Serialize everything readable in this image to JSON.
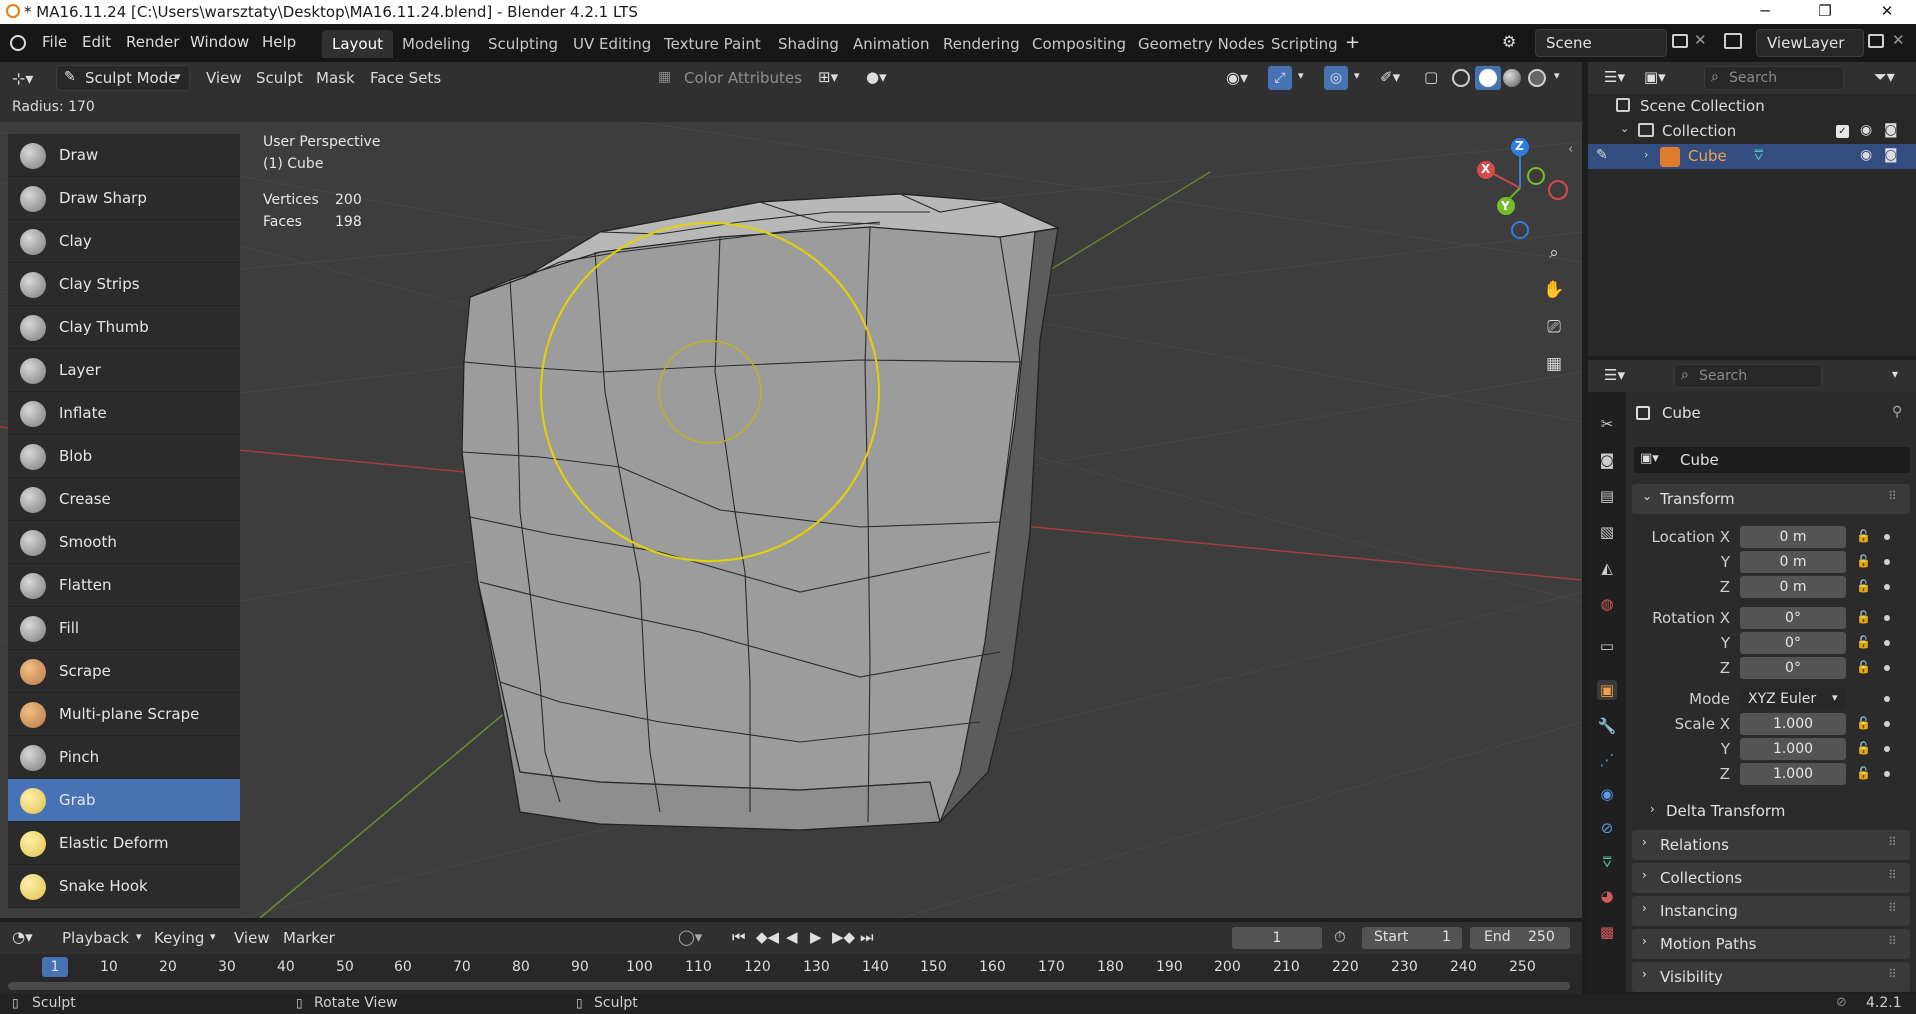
{
  "window": {
    "title": "* MA16.11.24 [C:\\Users\\warsztaty\\Desktop\\MA16.11.24.blend] - Blender 4.2.1 LTS",
    "controls": [
      "─",
      "❐",
      "✕"
    ]
  },
  "menu": [
    "File",
    "Edit",
    "Render",
    "Window",
    "Help"
  ],
  "workspaces": [
    "Layout",
    "Modeling",
    "Sculpting",
    "UV Editing",
    "Texture Paint",
    "Shading",
    "Animation",
    "Rendering",
    "Compositing",
    "Geometry Nodes",
    "Scripting"
  ],
  "active_workspace": "Layout",
  "scene": {
    "label": "Scene",
    "view_layer": "ViewLayer"
  },
  "viewport_header": {
    "mode": "Sculpt Mode",
    "menus": [
      "View",
      "Sculpt",
      "Mask",
      "Face Sets"
    ],
    "color_attributes": "Color Attributes",
    "radius": "Radius: 170"
  },
  "viewport": {
    "perspective": "User Perspective",
    "object": "(1) Cube",
    "stats": [
      {
        "label": "Vertices",
        "value": "200"
      },
      {
        "label": "Faces",
        "value": "198"
      }
    ],
    "gizmo": {
      "x": "X",
      "y": "Y",
      "z": "Z"
    }
  },
  "brushes": [
    {
      "label": "Draw",
      "style": "g"
    },
    {
      "label": "Draw Sharp",
      "style": "g"
    },
    {
      "label": "Clay",
      "style": "g"
    },
    {
      "label": "Clay Strips",
      "style": "g"
    },
    {
      "label": "Clay Thumb",
      "style": "g"
    },
    {
      "label": "Layer",
      "style": "g"
    },
    {
      "label": "Inflate",
      "style": "g"
    },
    {
      "label": "Blob",
      "style": "g"
    },
    {
      "label": "Crease",
      "style": "g"
    },
    {
      "label": "Smooth",
      "style": "g"
    },
    {
      "label": "Flatten",
      "style": "g"
    },
    {
      "label": "Fill",
      "style": "g"
    },
    {
      "label": "Scrape",
      "style": "c"
    },
    {
      "label": "Multi-plane Scrape",
      "style": "c"
    },
    {
      "label": "Pinch",
      "style": "g"
    },
    {
      "label": "Grab",
      "style": "y",
      "active": true
    },
    {
      "label": "Elastic Deform",
      "style": "y"
    },
    {
      "label": "Snake Hook",
      "style": "y"
    }
  ],
  "outliner": {
    "search_placeholder": "Search",
    "rows": [
      "Scene Collection",
      "Collection",
      "Cube"
    ]
  },
  "properties": {
    "search_placeholder": "Search",
    "object_name": "Cube",
    "object_field": "Cube",
    "transform": {
      "title": "Transform",
      "location_label": "Location X",
      "location": [
        "0 m",
        "0 m",
        "0 m"
      ],
      "rotation_label": "Rotation X",
      "rotation": [
        "0°",
        "0°",
        "0°"
      ],
      "mode_label": "Mode",
      "mode": "XYZ Euler",
      "scale_label": "Scale X",
      "scale": [
        "1.000",
        "1.000",
        "1.000"
      ],
      "axis_y": "Y",
      "axis_z": "Z"
    },
    "delta": "Delta Transform",
    "panels": [
      "Relations",
      "Collections",
      "Instancing",
      "Motion Paths",
      "Visibility"
    ]
  },
  "timeline": {
    "menus": [
      "Playback",
      "Keying",
      "View",
      "Marker"
    ],
    "current_frame": "1",
    "start_label": "Start",
    "start": "1",
    "end_label": "End",
    "end": "250",
    "ticks": [
      "1",
      "10",
      "20",
      "30",
      "40",
      "50",
      "60",
      "70",
      "80",
      "90",
      "100",
      "110",
      "120",
      "130",
      "140",
      "150",
      "160",
      "170",
      "180",
      "190",
      "200",
      "210",
      "220",
      "230",
      "240",
      "250"
    ]
  },
  "statusbar": {
    "left": "Sculpt",
    "middle": "Rotate View",
    "right": "Sculpt",
    "version": "4.2.1"
  }
}
